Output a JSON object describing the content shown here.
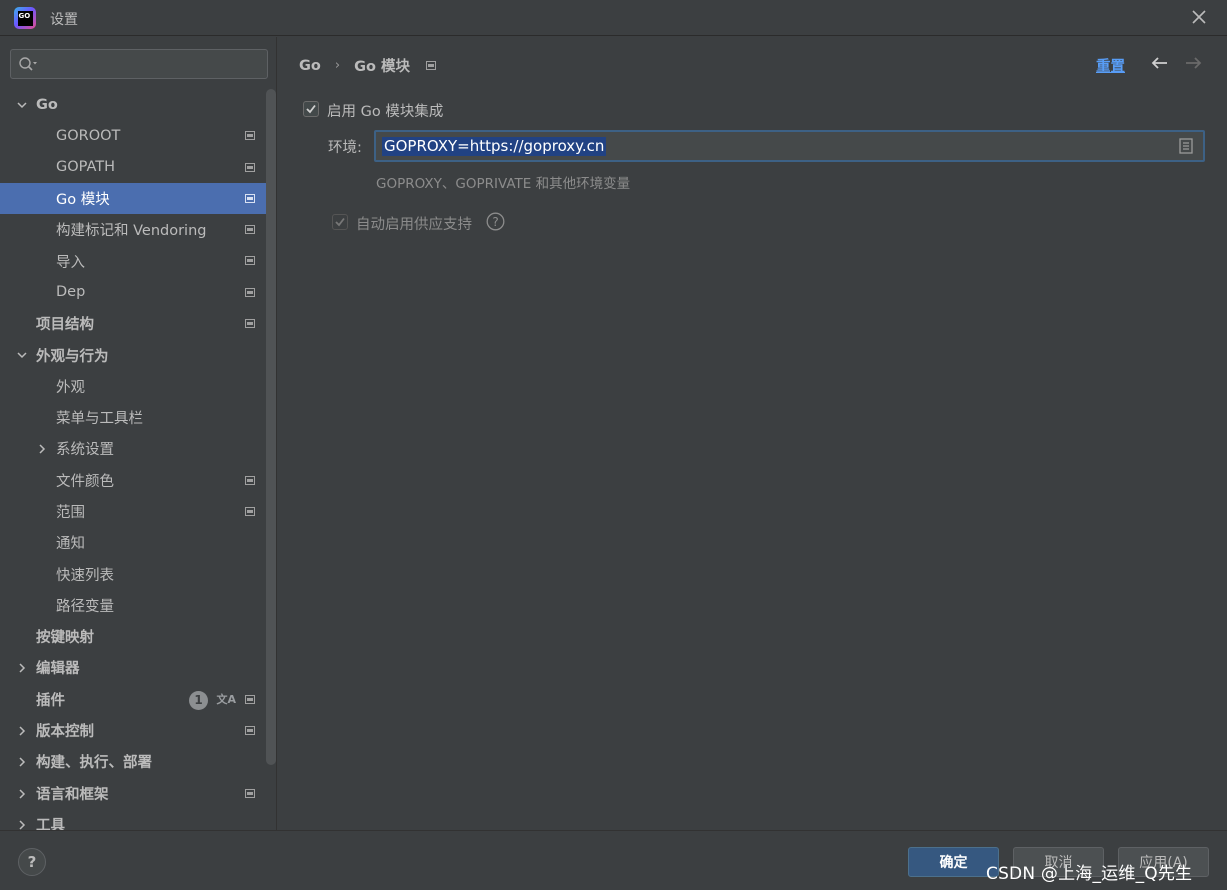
{
  "window": {
    "title": "设置",
    "app_icon_text": "GO"
  },
  "sidebar": {
    "search_placeholder": "",
    "items": [
      {
        "label": "Go",
        "level": 0,
        "expanded": true,
        "bold": true
      },
      {
        "label": "GOROOT",
        "level": 1,
        "project_icon": true
      },
      {
        "label": "GOPATH",
        "level": 1,
        "project_icon": true
      },
      {
        "label": "Go 模块",
        "level": 1,
        "project_icon": true,
        "selected": true
      },
      {
        "label": "构建标记和 Vendoring",
        "level": 1,
        "project_icon": true
      },
      {
        "label": "导入",
        "level": 1,
        "project_icon": true
      },
      {
        "label": "Dep",
        "level": 1,
        "project_icon": true
      },
      {
        "label": "项目结构",
        "level": 0,
        "bold": true,
        "project_icon": true
      },
      {
        "label": "外观与行为",
        "level": 0,
        "expanded": true,
        "bold": true
      },
      {
        "label": "外观",
        "level": 1
      },
      {
        "label": "菜单与工具栏",
        "level": 1
      },
      {
        "label": "系统设置",
        "level": 1,
        "collapsed": true
      },
      {
        "label": "文件颜色",
        "level": 1,
        "project_icon": true
      },
      {
        "label": "范围",
        "level": 1,
        "project_icon": true
      },
      {
        "label": "通知",
        "level": 1
      },
      {
        "label": "快速列表",
        "level": 1
      },
      {
        "label": "路径变量",
        "level": 1
      },
      {
        "label": "按键映射",
        "level": 0,
        "bold": true
      },
      {
        "label": "编辑器",
        "level": 0,
        "collapsed": true,
        "bold": true
      },
      {
        "label": "插件",
        "level": 0,
        "bold": true,
        "badge": "1",
        "translate_icon": true,
        "project_icon": true
      },
      {
        "label": "版本控制",
        "level": 0,
        "collapsed": true,
        "bold": true,
        "project_icon": true
      },
      {
        "label": "构建、执行、部署",
        "level": 0,
        "collapsed": true,
        "bold": true
      },
      {
        "label": "语言和框架",
        "level": 0,
        "collapsed": true,
        "bold": true,
        "project_icon": true
      },
      {
        "label": "工具",
        "level": 0,
        "collapsed": true,
        "bold": true
      }
    ]
  },
  "main": {
    "breadcrumb": {
      "parent": "Go",
      "separator": "›",
      "current": "Go 模块"
    },
    "reset_label": "重置",
    "enable_integration": {
      "label": "启用 Go 模块集成",
      "checked": true
    },
    "environment": {
      "label": "环境:",
      "value": "GOPROXY=https://goproxy.cn",
      "hint": "GOPROXY、GOPRIVATE 和其他环境变量"
    },
    "vendoring": {
      "label": "自动启用供应支持",
      "checked": true,
      "disabled": true
    },
    "help_glyph": "?"
  },
  "footer": {
    "help_glyph": "?",
    "ok_label": "确定",
    "cancel_label": "取消",
    "apply_label": "应用(A)",
    "watermark": "CSDN @上海_运维_Q先生"
  },
  "colors": {
    "background": "#3c3f41",
    "selection": "#4b6eaf",
    "link": "#589df6",
    "primary_button": "#365880"
  }
}
